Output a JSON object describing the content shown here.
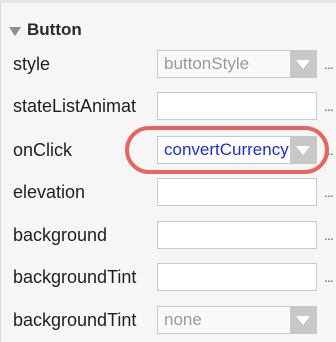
{
  "section": {
    "title": "Button",
    "expanded": true
  },
  "rows": [
    {
      "label": "style",
      "value": "buttonStyle",
      "kind": "select"
    },
    {
      "label": "stateListAnimat",
      "value": "",
      "kind": "text"
    },
    {
      "label": "onClick",
      "value": "convertCurrency",
      "kind": "select-highlight"
    },
    {
      "label": "elevation",
      "value": "",
      "kind": "text"
    },
    {
      "label": "background",
      "value": "",
      "kind": "text"
    },
    {
      "label": "backgroundTint",
      "value": "",
      "kind": "text"
    },
    {
      "label": "backgroundTint",
      "value": "none",
      "kind": "select"
    }
  ],
  "more_label": "...",
  "colors": {
    "value_text": "#1a2fd6",
    "highlight_circle": "#e8655f",
    "dropdown_button": "#c8c8c8"
  },
  "icons": [
    "expand-triangle-icon",
    "dropdown-arrow-icon",
    "more-dots-icon"
  ]
}
